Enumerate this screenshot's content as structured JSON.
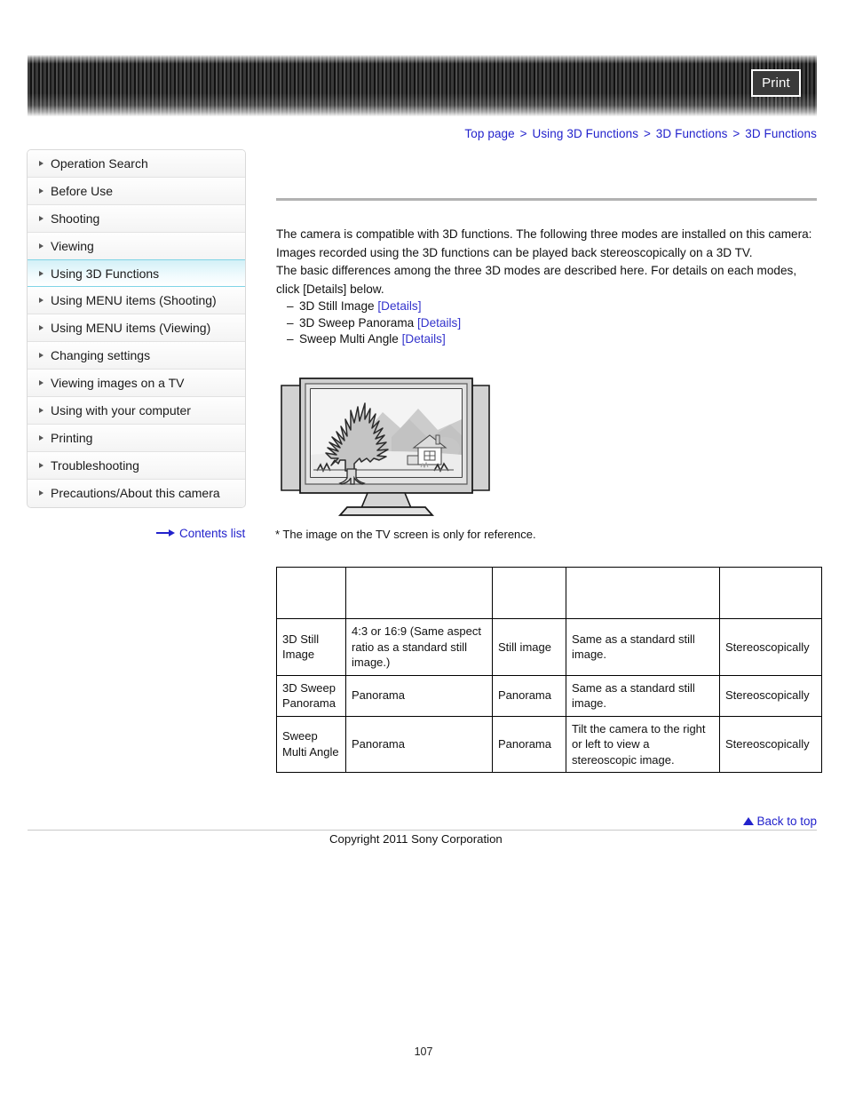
{
  "header": {
    "print_label": "Print"
  },
  "breadcrumb": {
    "separator": ">",
    "items": [
      {
        "label": "Top page"
      },
      {
        "label": "Using 3D Functions"
      },
      {
        "label": "3D Functions"
      },
      {
        "label": "3D Functions"
      }
    ]
  },
  "sidebar": {
    "items": [
      {
        "label": "Operation Search",
        "selected": false
      },
      {
        "label": "Before Use",
        "selected": false
      },
      {
        "label": "Shooting",
        "selected": false
      },
      {
        "label": "Viewing",
        "selected": false
      },
      {
        "label": "Using 3D Functions",
        "selected": true
      },
      {
        "label": "Using MENU items (Shooting)",
        "selected": false
      },
      {
        "label": "Using MENU items (Viewing)",
        "selected": false
      },
      {
        "label": "Changing settings",
        "selected": false
      },
      {
        "label": "Viewing images on a TV",
        "selected": false
      },
      {
        "label": "Using with your computer",
        "selected": false
      },
      {
        "label": "Printing",
        "selected": false
      },
      {
        "label": "Troubleshooting",
        "selected": false
      },
      {
        "label": "Precautions/About this camera",
        "selected": false
      }
    ],
    "contents_list_label": "Contents list"
  },
  "main": {
    "paragraph_1": "The camera is compatible with 3D functions. The following three modes are installed on this camera:",
    "paragraph_2": "Images recorded using the 3D functions can be played back stereoscopically on a 3D TV.",
    "paragraph_3": "The basic differences among the three 3D modes are described here. For details on each modes, click [Details] below.",
    "mode_list": [
      {
        "dash": "–",
        "name": "3D Still Image",
        "link": "[Details]"
      },
      {
        "dash": "–",
        "name": "3D Sweep Panorama",
        "link": "[Details]"
      },
      {
        "dash": "–",
        "name": "Sweep Multi Angle",
        "link": "[Details]"
      }
    ],
    "figure_note": "* The image on the TV screen is only for reference."
  },
  "table": {
    "header_row": [
      "",
      "",
      "",
      "",
      ""
    ],
    "rows": [
      {
        "mode": "3D Still Image",
        "aspect": "4:3 or 16:9 (Same aspect ratio as a standard still image.)",
        "type": "Still image",
        "playback": "Same as a standard still image.",
        "view": "Stereoscopically"
      },
      {
        "mode": "3D Sweep Panorama",
        "aspect": "Panorama",
        "type": "Panorama",
        "playback": "Same as a standard still image.",
        "view": "Stereoscopically"
      },
      {
        "mode": "Sweep Multi Angle",
        "aspect": "Panorama",
        "type": "Panorama",
        "playback": "Tilt the camera to the right or left to view a stereoscopic image.",
        "view": "Stereoscopically"
      }
    ]
  },
  "footer": {
    "back_to_top_label": "Back to top",
    "copyright": "Copyright 2011 Sony Corporation",
    "page_number": "107"
  },
  "colors": {
    "link": "#2222cc",
    "selected_nav_border": "#7fd4e6",
    "rule": "#b2b2b2"
  }
}
